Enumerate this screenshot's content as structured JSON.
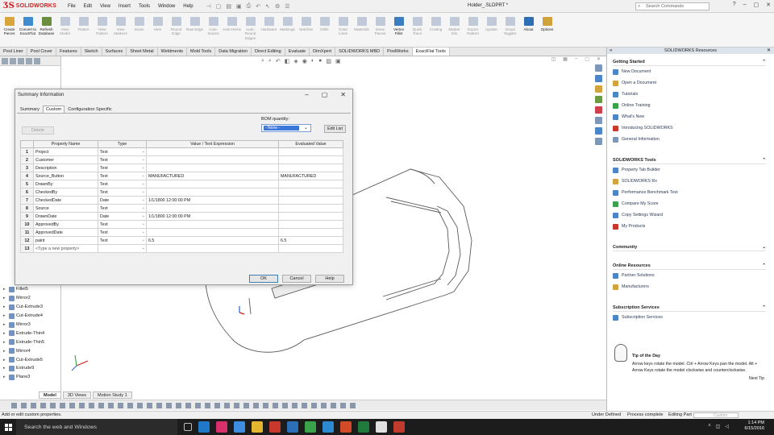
{
  "app": {
    "logo_text": "SOLIDWORKS",
    "document_title": "Holder_.SLDPRT *",
    "menus": [
      "File",
      "Edit",
      "View",
      "Insert",
      "Tools",
      "Window",
      "Help"
    ],
    "search_placeholder": "Search Commands"
  },
  "commands": [
    {
      "label": "Create Pieces",
      "enabled": true,
      "color": "#d8a63a"
    },
    {
      "label": "Convert to ExactFlat",
      "enabled": true,
      "color": "#3f8ccf"
    },
    {
      "label": "Refresh Database",
      "enabled": true,
      "color": "#6b8e3e"
    },
    {
      "label": "View Model",
      "enabled": false,
      "color": "#7e94b3"
    },
    {
      "label": "Flatten",
      "enabled": false,
      "color": "#7e94b3"
    },
    {
      "label": "View Pattern",
      "enabled": false,
      "color": "#7e94b3"
    },
    {
      "label": "View Markers",
      "enabled": false,
      "color": "#7e94b3"
    },
    {
      "label": "Seam",
      "enabled": false,
      "color": "#7e94b3"
    },
    {
      "label": "Hem",
      "enabled": false,
      "color": "#7e94b3"
    },
    {
      "label": "Round Edge",
      "enabled": false,
      "color": "#7e94b3"
    },
    {
      "label": "Raw Edge",
      "enabled": false,
      "color": "#7e94b3"
    },
    {
      "label": "Auto-Seams",
      "enabled": false,
      "color": "#7e94b3"
    },
    {
      "label": "Auto-Hems",
      "enabled": false,
      "color": "#7e94b3"
    },
    {
      "label": "Auto-Round Edges",
      "enabled": false,
      "color": "#7e94b3"
    },
    {
      "label": "Hardware",
      "enabled": false,
      "color": "#7e94b3"
    },
    {
      "label": "Markings",
      "enabled": false,
      "color": "#7e94b3"
    },
    {
      "label": "Notches",
      "enabled": false,
      "color": "#7e94b3"
    },
    {
      "label": "Drills",
      "enabled": false,
      "color": "#7e94b3"
    },
    {
      "label": "Grain Lines",
      "enabled": false,
      "color": "#7e94b3"
    },
    {
      "label": "Materials",
      "enabled": false,
      "color": "#7e94b3"
    },
    {
      "label": "Move Pieces",
      "enabled": false,
      "color": "#7e94b3"
    },
    {
      "label": "Vertex Fillet",
      "enabled": true,
      "color": "#3e7cc2"
    },
    {
      "label": "Quick Trace",
      "enabled": false,
      "color": "#7e94b3"
    },
    {
      "label": "Costing",
      "enabled": false,
      "color": "#7e94b3"
    },
    {
      "label": "Marker Info",
      "enabled": false,
      "color": "#7e94b3"
    },
    {
      "label": "Export Pattern",
      "enabled": false,
      "color": "#7e94b3"
    },
    {
      "label": "Update",
      "enabled": false,
      "color": "#7e94b3"
    },
    {
      "label": "Visual Toggles",
      "enabled": false,
      "color": "#7e94b3"
    },
    {
      "label": "About",
      "enabled": true,
      "color": "#2f6db5"
    },
    {
      "label": "Options",
      "enabled": true,
      "color": "#d0a23b"
    }
  ],
  "cm_tabs": [
    "Pool Liner",
    "Pool Cover",
    "Features",
    "Sketch",
    "Surfaces",
    "Sheet Metal",
    "Weldments",
    "Mold Tools",
    "Data Migration",
    "Direct Editing",
    "Evaluate",
    "DimXpert",
    "SOLIDWORKS MBD",
    "PoolWorks",
    "ExactFlat Tools"
  ],
  "cm_active_tab": "ExactFlat Tools",
  "feature_tree": [
    "Fillet5",
    "Mirror2",
    "Cut-Extrude3",
    "Cut-Extrude4",
    "Mirror3",
    "Extrude-Thin4",
    "Extrude-Thin5",
    "Mirror4",
    "Cut-Extrude5",
    "Extrude9",
    "Plane3"
  ],
  "model_tabs": [
    "Model",
    "3D Views",
    "Motion Study 1"
  ],
  "model_tab_active": "Model",
  "status": {
    "left": "Add or edit custom properties.",
    "under_defined": "Under Defined",
    "process": "Process complete",
    "editing": "Editing Part",
    "custom": "Custom"
  },
  "taskbar": {
    "search": "Search the web and Windows",
    "time": "1:14 PM",
    "date": "6/15/2016"
  },
  "taskpane": {
    "title": "SOLIDWORKS Resources",
    "getting_started": {
      "title": "Getting Started",
      "links": [
        "New Document",
        "Open a Document",
        "Tutorials",
        "Online Training",
        "What's New",
        "Introducing SOLIDWORKS",
        "General Information"
      ]
    },
    "tools": {
      "title": "SOLIDWORKS Tools",
      "links": [
        "Property Tab Builder",
        "SOLIDWORKS Rx",
        "Performance Benchmark Test",
        "Compare My Score",
        "Copy Settings Wizard",
        "My Products"
      ]
    },
    "community": {
      "title": "Community"
    },
    "online_resources": {
      "title": "Online Resources",
      "links": [
        "Partner Solutions",
        "Manufacturers"
      ]
    },
    "subscription": {
      "title": "Subscription Services",
      "links": [
        "Subscription Services"
      ]
    },
    "tip": {
      "title": "Tip of the Day",
      "text": "Arrow keys rotate the model. Ctrl + Arrow Keys pan the model. Alt + Arrow Keys rotate the model clockwise and counterclockwise.",
      "next": "Next Tip"
    }
  },
  "dialog": {
    "title": "Summary Information",
    "tabs": [
      "Summary",
      "Custom",
      "Configuration Specific"
    ],
    "active_tab": "Custom",
    "delete_label": "Delete",
    "bom_label": "BOM quantity:",
    "bom_value": "- None -",
    "edit_list_label": "Edit List",
    "columns": [
      "Property Name",
      "Type",
      "Value / Text Expression",
      "Evaluated Value"
    ],
    "rows": [
      {
        "n": "1",
        "name": "Project",
        "type": "Text",
        "value": "",
        "evaluated": ""
      },
      {
        "n": "2",
        "name": "Customer",
        "type": "Text",
        "value": "",
        "evaluated": ""
      },
      {
        "n": "3",
        "name": "Description",
        "type": "Text",
        "value": "",
        "evaluated": ""
      },
      {
        "n": "4",
        "name": "Source_Button",
        "type": "Text",
        "value": "MANUFACTURED",
        "evaluated": "MANUFACTURED"
      },
      {
        "n": "5",
        "name": "DrawnBy",
        "type": "Text",
        "value": "",
        "evaluated": ""
      },
      {
        "n": "6",
        "name": "CheckedBy",
        "type": "Text",
        "value": "",
        "evaluated": ""
      },
      {
        "n": "7",
        "name": "CheckedDate",
        "type": "Date",
        "value": "1/1/1800 12:00:00 PM",
        "evaluated": ""
      },
      {
        "n": "8",
        "name": "Source",
        "type": "Text",
        "value": "",
        "evaluated": ""
      },
      {
        "n": "9",
        "name": "DrawnDate",
        "type": "Date",
        "value": "1/1/1800 12:00:00 PM",
        "evaluated": ""
      },
      {
        "n": "10",
        "name": "ApprovedBy",
        "type": "Text",
        "value": "",
        "evaluated": ""
      },
      {
        "n": "11",
        "name": "ApprovedDate",
        "type": "Text",
        "value": "",
        "evaluated": ""
      },
      {
        "n": "12",
        "name": "paint",
        "type": "Text",
        "value": "6.5",
        "evaluated": "6.5"
      },
      {
        "n": "13",
        "name": "<Type a new property>",
        "type": "",
        "value": "",
        "evaluated": ""
      }
    ],
    "ok_label": "OK",
    "cancel_label": "Cancel",
    "help_label": "Help"
  }
}
